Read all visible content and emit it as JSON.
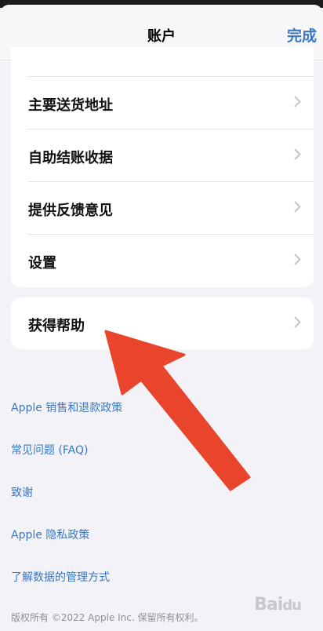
{
  "nav": {
    "title": "账户",
    "done": "完成"
  },
  "main_menu": [
    {
      "label": "主要送货地址"
    },
    {
      "label": "自助结账收据"
    },
    {
      "label": "提供反馈意见"
    },
    {
      "label": "设置"
    }
  ],
  "help": {
    "label": "获得帮助"
  },
  "links": [
    "Apple 销售和退款政策",
    "常见问题 (FAQ)",
    "致谢",
    "Apple 隐私政策",
    "了解数据的管理方式"
  ],
  "footer": "版权所有 ©2022 Apple Inc. 保留所有权利。",
  "watermark": "Baidu 经验",
  "colors": {
    "accent": "#3a78c3",
    "arrow": "#e8452c",
    "background": "#f2f2f7"
  }
}
